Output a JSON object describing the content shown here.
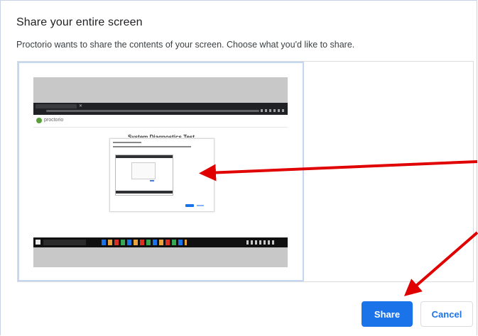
{
  "dialog": {
    "title": "Share your entire screen",
    "subtitle": "Proctorio wants to share the contents of your screen. Choose what you'd like to share."
  },
  "thumbnail": {
    "site_name": "proctorio",
    "page_heading": "System Diagnostics Test"
  },
  "buttons": {
    "share_label": "Share",
    "cancel_label": "Cancel"
  },
  "colors": {
    "accent": "#1a73e8",
    "annotation_arrow": "#e00000",
    "selection_border": "#c3d7f2"
  }
}
